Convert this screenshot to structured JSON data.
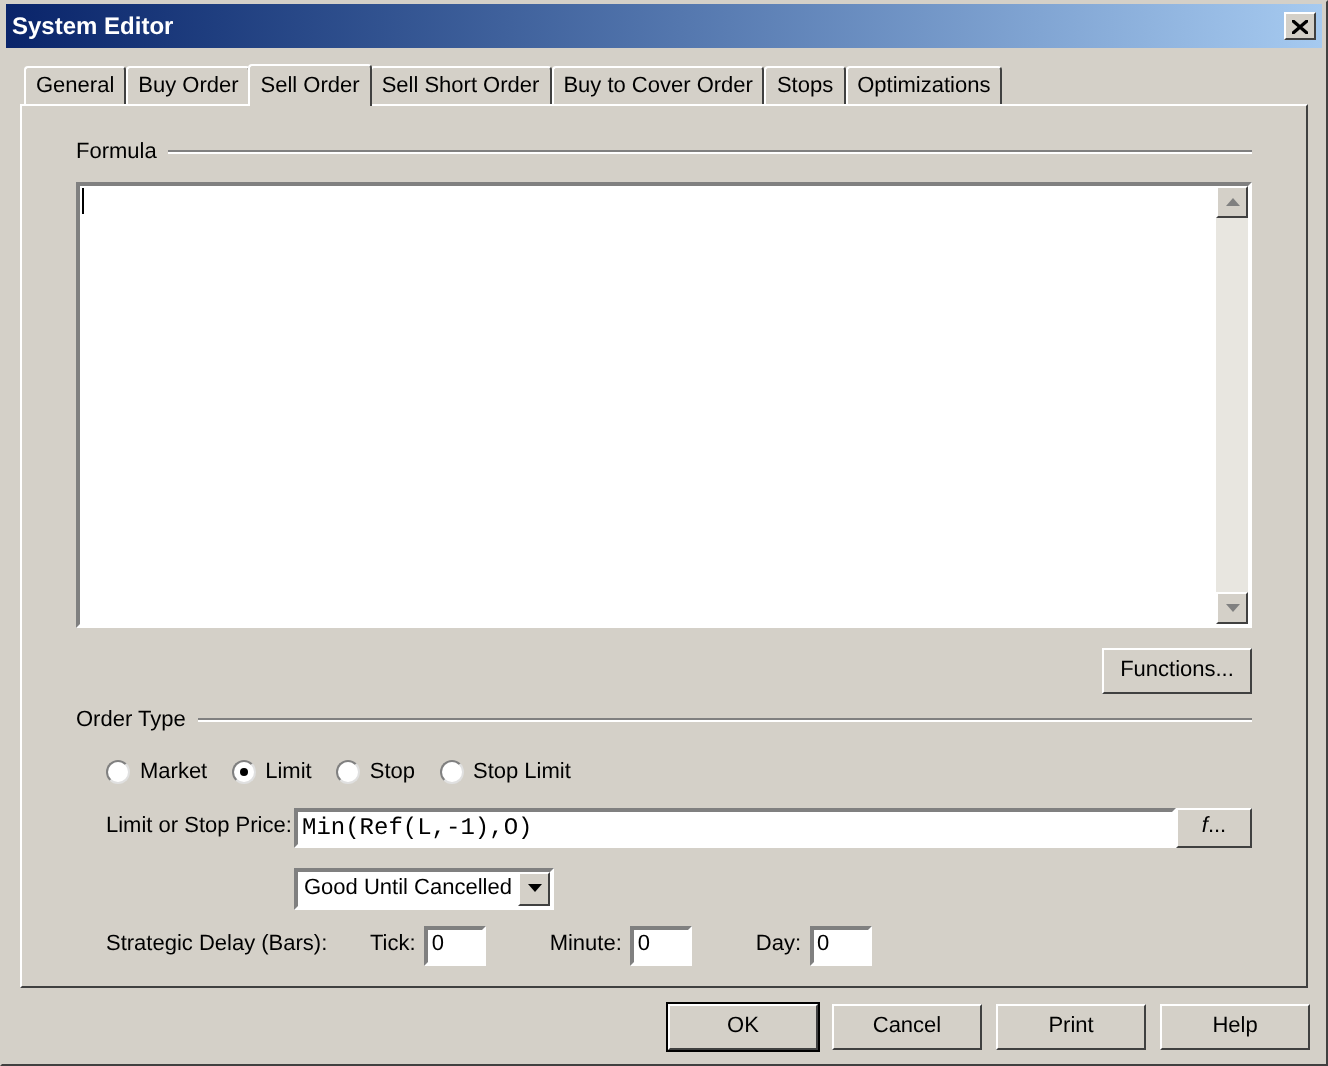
{
  "window": {
    "title": "System Editor"
  },
  "tabs": [
    {
      "label": "General",
      "selected": false
    },
    {
      "label": "Buy Order",
      "selected": false
    },
    {
      "label": "Sell Order",
      "selected": true
    },
    {
      "label": "Sell Short Order",
      "selected": false
    },
    {
      "label": "Buy to Cover Order",
      "selected": false
    },
    {
      "label": "Stops",
      "selected": false
    },
    {
      "label": "Optimizations",
      "selected": false
    }
  ],
  "formula": {
    "label": "Formula"
  },
  "functions_button": "Functions...",
  "order_type": {
    "label": "Order Type",
    "options": [
      {
        "label": "Market",
        "selected": false
      },
      {
        "label": "Limit",
        "selected": true
      },
      {
        "label": "Stop",
        "selected": false
      },
      {
        "label": "Stop Limit",
        "selected": false
      }
    ]
  },
  "price": {
    "label": "Limit or Stop Price:",
    "value": "Min(Ref(L,-1),O)",
    "button": "*f*..."
  },
  "duration": {
    "value": "Good Until Cancelled"
  },
  "delay": {
    "label": "Strategic Delay (Bars):",
    "fields": [
      {
        "label": "Tick:",
        "value": "0"
      },
      {
        "label": "Minute:",
        "value": "0"
      },
      {
        "label": "Day:",
        "value": "0"
      }
    ]
  },
  "buttons": [
    {
      "label": "OK",
      "default": true
    },
    {
      "label": "Cancel",
      "default": false
    },
    {
      "label": "Print",
      "default": false
    },
    {
      "label": "Help",
      "default": false
    }
  ]
}
